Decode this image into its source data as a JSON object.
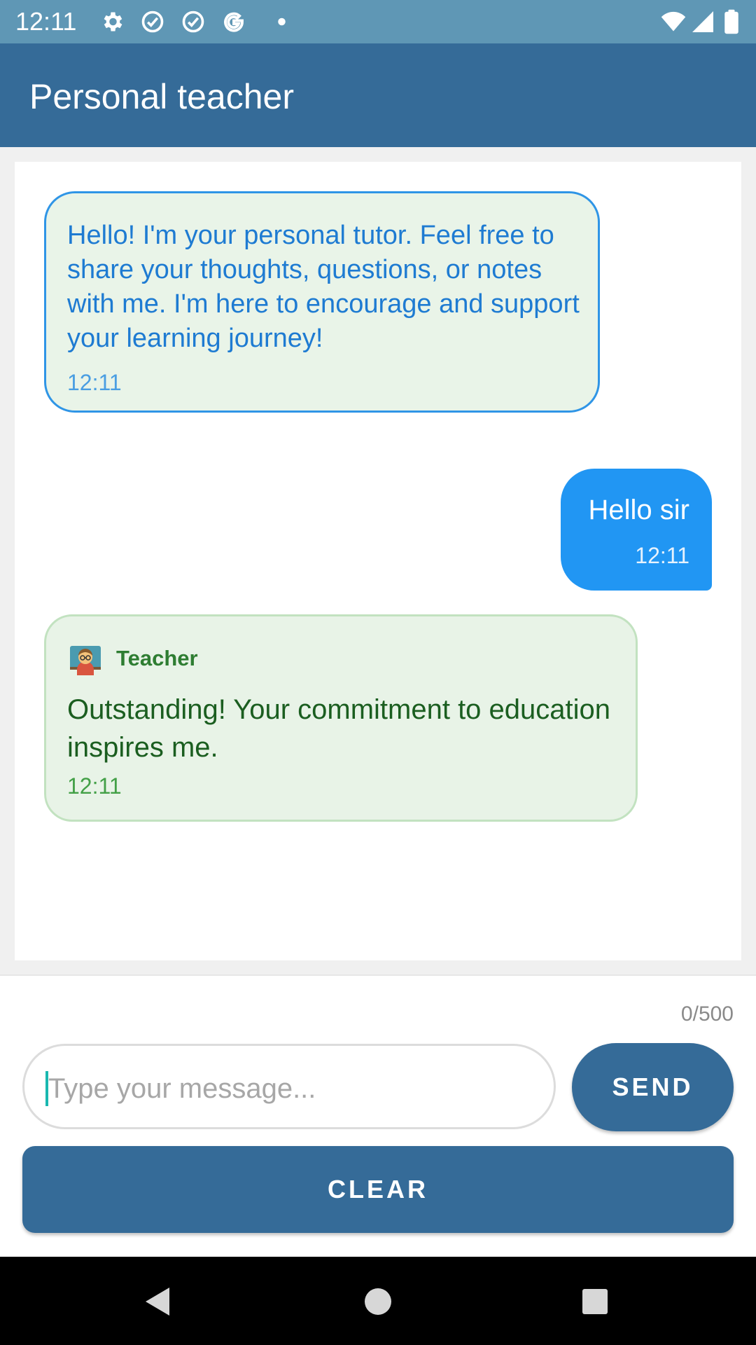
{
  "status_bar": {
    "time": "12:11",
    "icons": [
      "gear-icon",
      "check-circle-icon",
      "check-circle-icon",
      "google-icon",
      "dot-icon",
      "wifi-icon",
      "signal-icon",
      "battery-icon"
    ]
  },
  "app_bar": {
    "title": "Personal teacher"
  },
  "messages": [
    {
      "sender": "tutor",
      "text": "Hello! I'm your personal tutor. Feel free to share your thoughts, questions, or notes with me. I'm here to encourage and support your learning journey!",
      "time": "12:11"
    },
    {
      "sender": "user",
      "text": "Hello sir",
      "time": "12:11"
    },
    {
      "sender": "teacher",
      "name": "Teacher",
      "avatar": "teacher-avatar-icon",
      "text": "Outstanding! Your commitment to education inspires me.",
      "time": "12:11"
    }
  ],
  "composer": {
    "char_counter": "0/500",
    "placeholder": "Type your message...",
    "value": "",
    "send_label": "SEND",
    "clear_label": "CLEAR"
  },
  "nav_bar": {
    "icons": [
      "back-triangle-icon",
      "home-circle-icon",
      "recents-square-icon"
    ]
  },
  "colors": {
    "status_bar": "#5f97b5",
    "app_bar": "#356b98",
    "user_bubble": "#2196f3",
    "tutor_border": "#2f95e6",
    "teacher_text": "#1b5e20",
    "button": "#356b98"
  }
}
